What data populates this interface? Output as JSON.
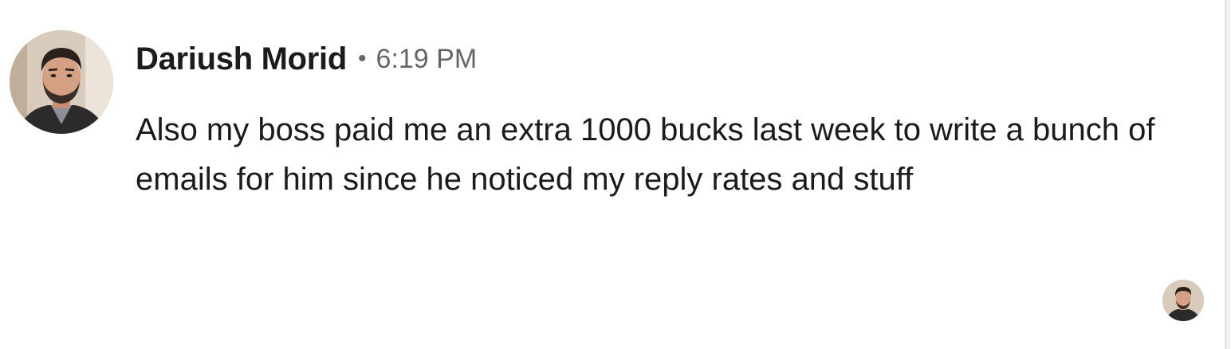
{
  "message": {
    "sender_name": "Dariush Morid",
    "separator": "•",
    "timestamp": "6:19 PM",
    "text": "Also my boss paid me an extra 1000 bucks last week to write a bunch of emails for him since he noticed my reply rates and stuff",
    "avatar_icon": "profile-photo-avatar",
    "seen_icon": "seen-by-avatar"
  }
}
